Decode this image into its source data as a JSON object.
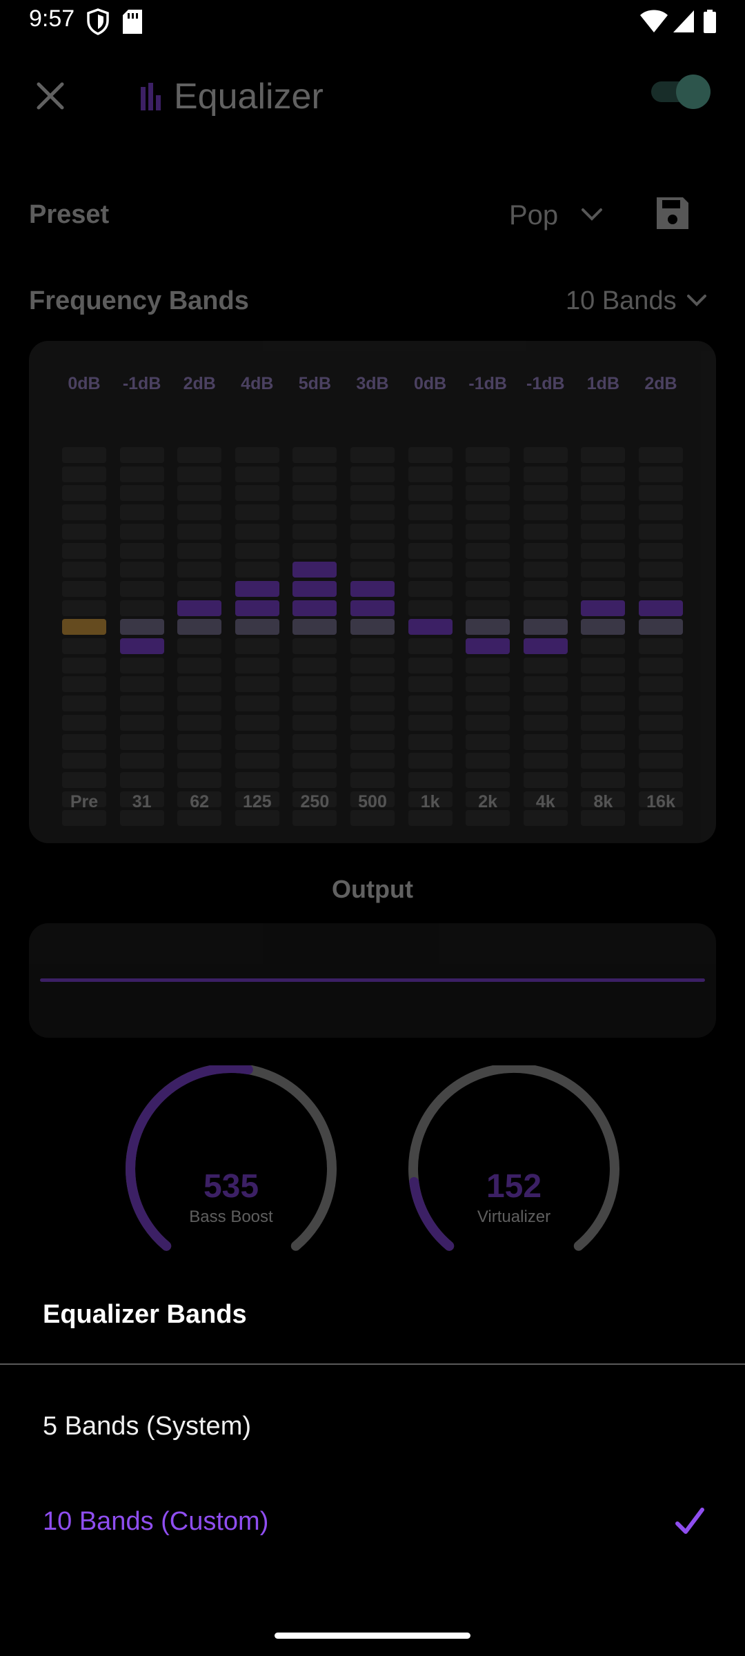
{
  "status_bar": {
    "time": "9:57"
  },
  "header": {
    "title": "Equalizer",
    "enabled": true
  },
  "preset": {
    "label": "Preset",
    "value": "Pop"
  },
  "frequency_bands": {
    "label": "Frequency Bands",
    "value": "10 Bands",
    "bands": [
      {
        "freq": "Pre",
        "db_label": "0dB",
        "db": 0
      },
      {
        "freq": "31",
        "db_label": "-1dB",
        "db": -1
      },
      {
        "freq": "62",
        "db_label": "2dB",
        "db": 2
      },
      {
        "freq": "125",
        "db_label": "4dB",
        "db": 4
      },
      {
        "freq": "250",
        "db_label": "5dB",
        "db": 5
      },
      {
        "freq": "500",
        "db_label": "3dB",
        "db": 3
      },
      {
        "freq": "1k",
        "db_label": "0dB",
        "db": 0
      },
      {
        "freq": "2k",
        "db_label": "-1dB",
        "db": -1
      },
      {
        "freq": "4k",
        "db_label": "-1dB",
        "db": -1
      },
      {
        "freq": "8k",
        "db_label": "1dB",
        "db": 1
      },
      {
        "freq": "16k",
        "db_label": "2dB",
        "db": 2
      }
    ]
  },
  "output": {
    "label": "Output"
  },
  "knobs": {
    "bass_boost": {
      "value": "535",
      "label": "Bass Boost",
      "fraction": 0.535
    },
    "virtualizer": {
      "value": "152",
      "label": "Virtualizer",
      "fraction": 0.152
    }
  },
  "sheet": {
    "title": "Equalizer Bands",
    "options": [
      {
        "label": "5 Bands (System)",
        "selected": false
      },
      {
        "label": "10 Bands (Custom)",
        "selected": true
      }
    ]
  },
  "colors": {
    "accent": "#8f4ef0",
    "pre_amp": "#f0b24a",
    "toggle_on": "#6ccab6"
  }
}
